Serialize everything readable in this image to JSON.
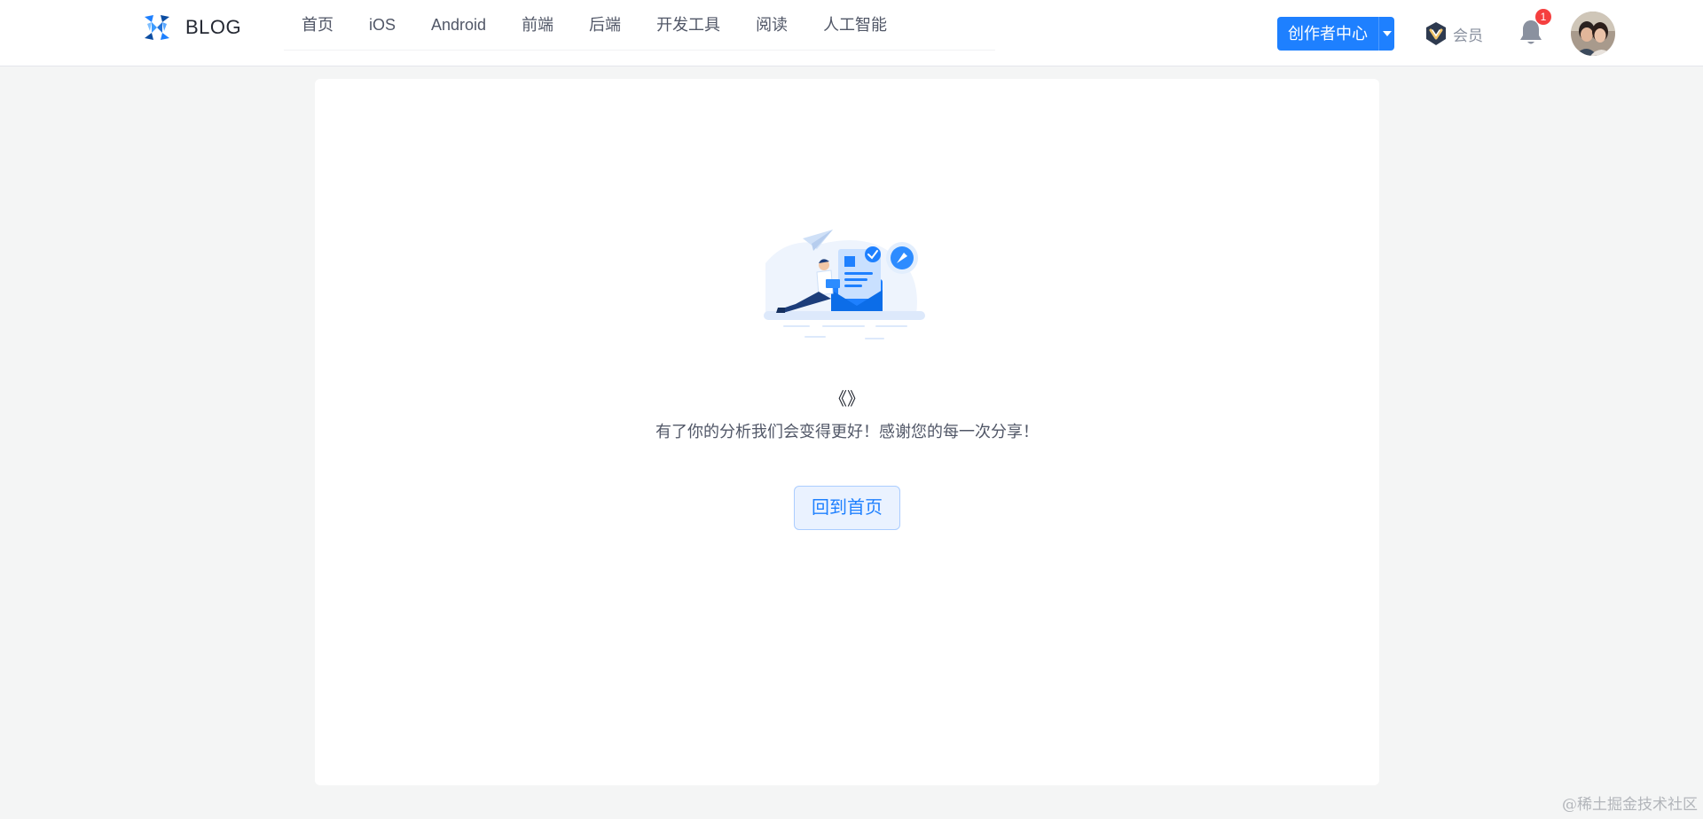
{
  "header": {
    "logo_text": "BLOG",
    "nav": [
      "首页",
      "iOS",
      "Android",
      "前端",
      "后端",
      "开发工具",
      "阅读",
      "人工智能"
    ],
    "creator_label": "创作者中心",
    "vip_label": "会员",
    "notification_count": "1",
    "brand_color": "#1e80ff"
  },
  "main": {
    "title": "《》",
    "message": "有了你的分析我们会变得更好！感谢您的每一次分享！",
    "home_button": "回到首页"
  },
  "watermark": "@稀土掘金技术社区",
  "icons": {
    "logo": "blog-logo-icon",
    "creator_dropdown": "caret-down-icon",
    "vip": "vip-badge-icon",
    "bell": "bell-icon",
    "avatar": "user-avatar"
  }
}
